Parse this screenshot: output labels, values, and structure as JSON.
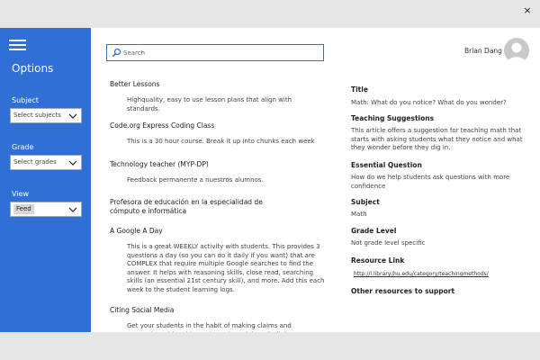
{
  "window": {
    "close_glyph": "×"
  },
  "sidebar": {
    "title": "Options",
    "filters": [
      {
        "label": "Subject",
        "value": "Select subjects"
      },
      {
        "label": "Grade",
        "value": "Select grades"
      },
      {
        "label": "View",
        "value": "Feed"
      }
    ]
  },
  "search": {
    "placeholder": "Search",
    "value": ""
  },
  "user": {
    "name": "Brian Dang"
  },
  "items": [
    {
      "title": "Better Lessons",
      "desc": "Highquality, easy to use lesson plans that align with standards."
    },
    {
      "title": "Code.org Express Coding Class",
      "desc": "This is a 30 hour course. Break it up into chunks each week"
    },
    {
      "title": "Technology teacher (MYP-DP)",
      "desc": "Feedback permanente a nuestros alumnos."
    },
    {
      "title": "Profesora de educación en la especialidad de cómputo e informática",
      "desc": ""
    },
    {
      "title": "A Google A Day",
      "desc": "This is a great WEEKLY activity with students. This provides 3 questions a day (so you can do it daily if you want) that are COMPLEX that require multiple Google searches to find the answer. It helps with reasoning skills, close read, searching skills (an essential 21st century skill), and more. Add this each week to the student learning logs."
    },
    {
      "title": "Citing Social Media",
      "desc": "Get your students in the habit of making claims and supporting with evidence (CCSS). Social media links, ... use this to create citations"
    }
  ],
  "detail": {
    "title_label": "Title",
    "title_value": "Math: What do you notice? What do you wonder?",
    "suggestions_label": "Teaching Suggestions",
    "suggestions_value": "This article offers a suggestion for teaching math that starts with asking students what they notice and what they wonder before they dig in.",
    "question_label": "Essential Question",
    "question_value": "How do we help students ask questions with more confidence",
    "subject_label": "Subject",
    "subject_value": "Math",
    "grade_label": "Grade Level",
    "grade_value": "Not grade level specific",
    "resource_label": "Resource Link",
    "resource_value": "http://l.library.jhu.edu/category/teachingmethods/",
    "other_label": "Other resources to support"
  },
  "colors": {
    "sidebar": "#2f6fd6",
    "accent": "#3b6fb6",
    "chrome": "#e6e6e6"
  }
}
